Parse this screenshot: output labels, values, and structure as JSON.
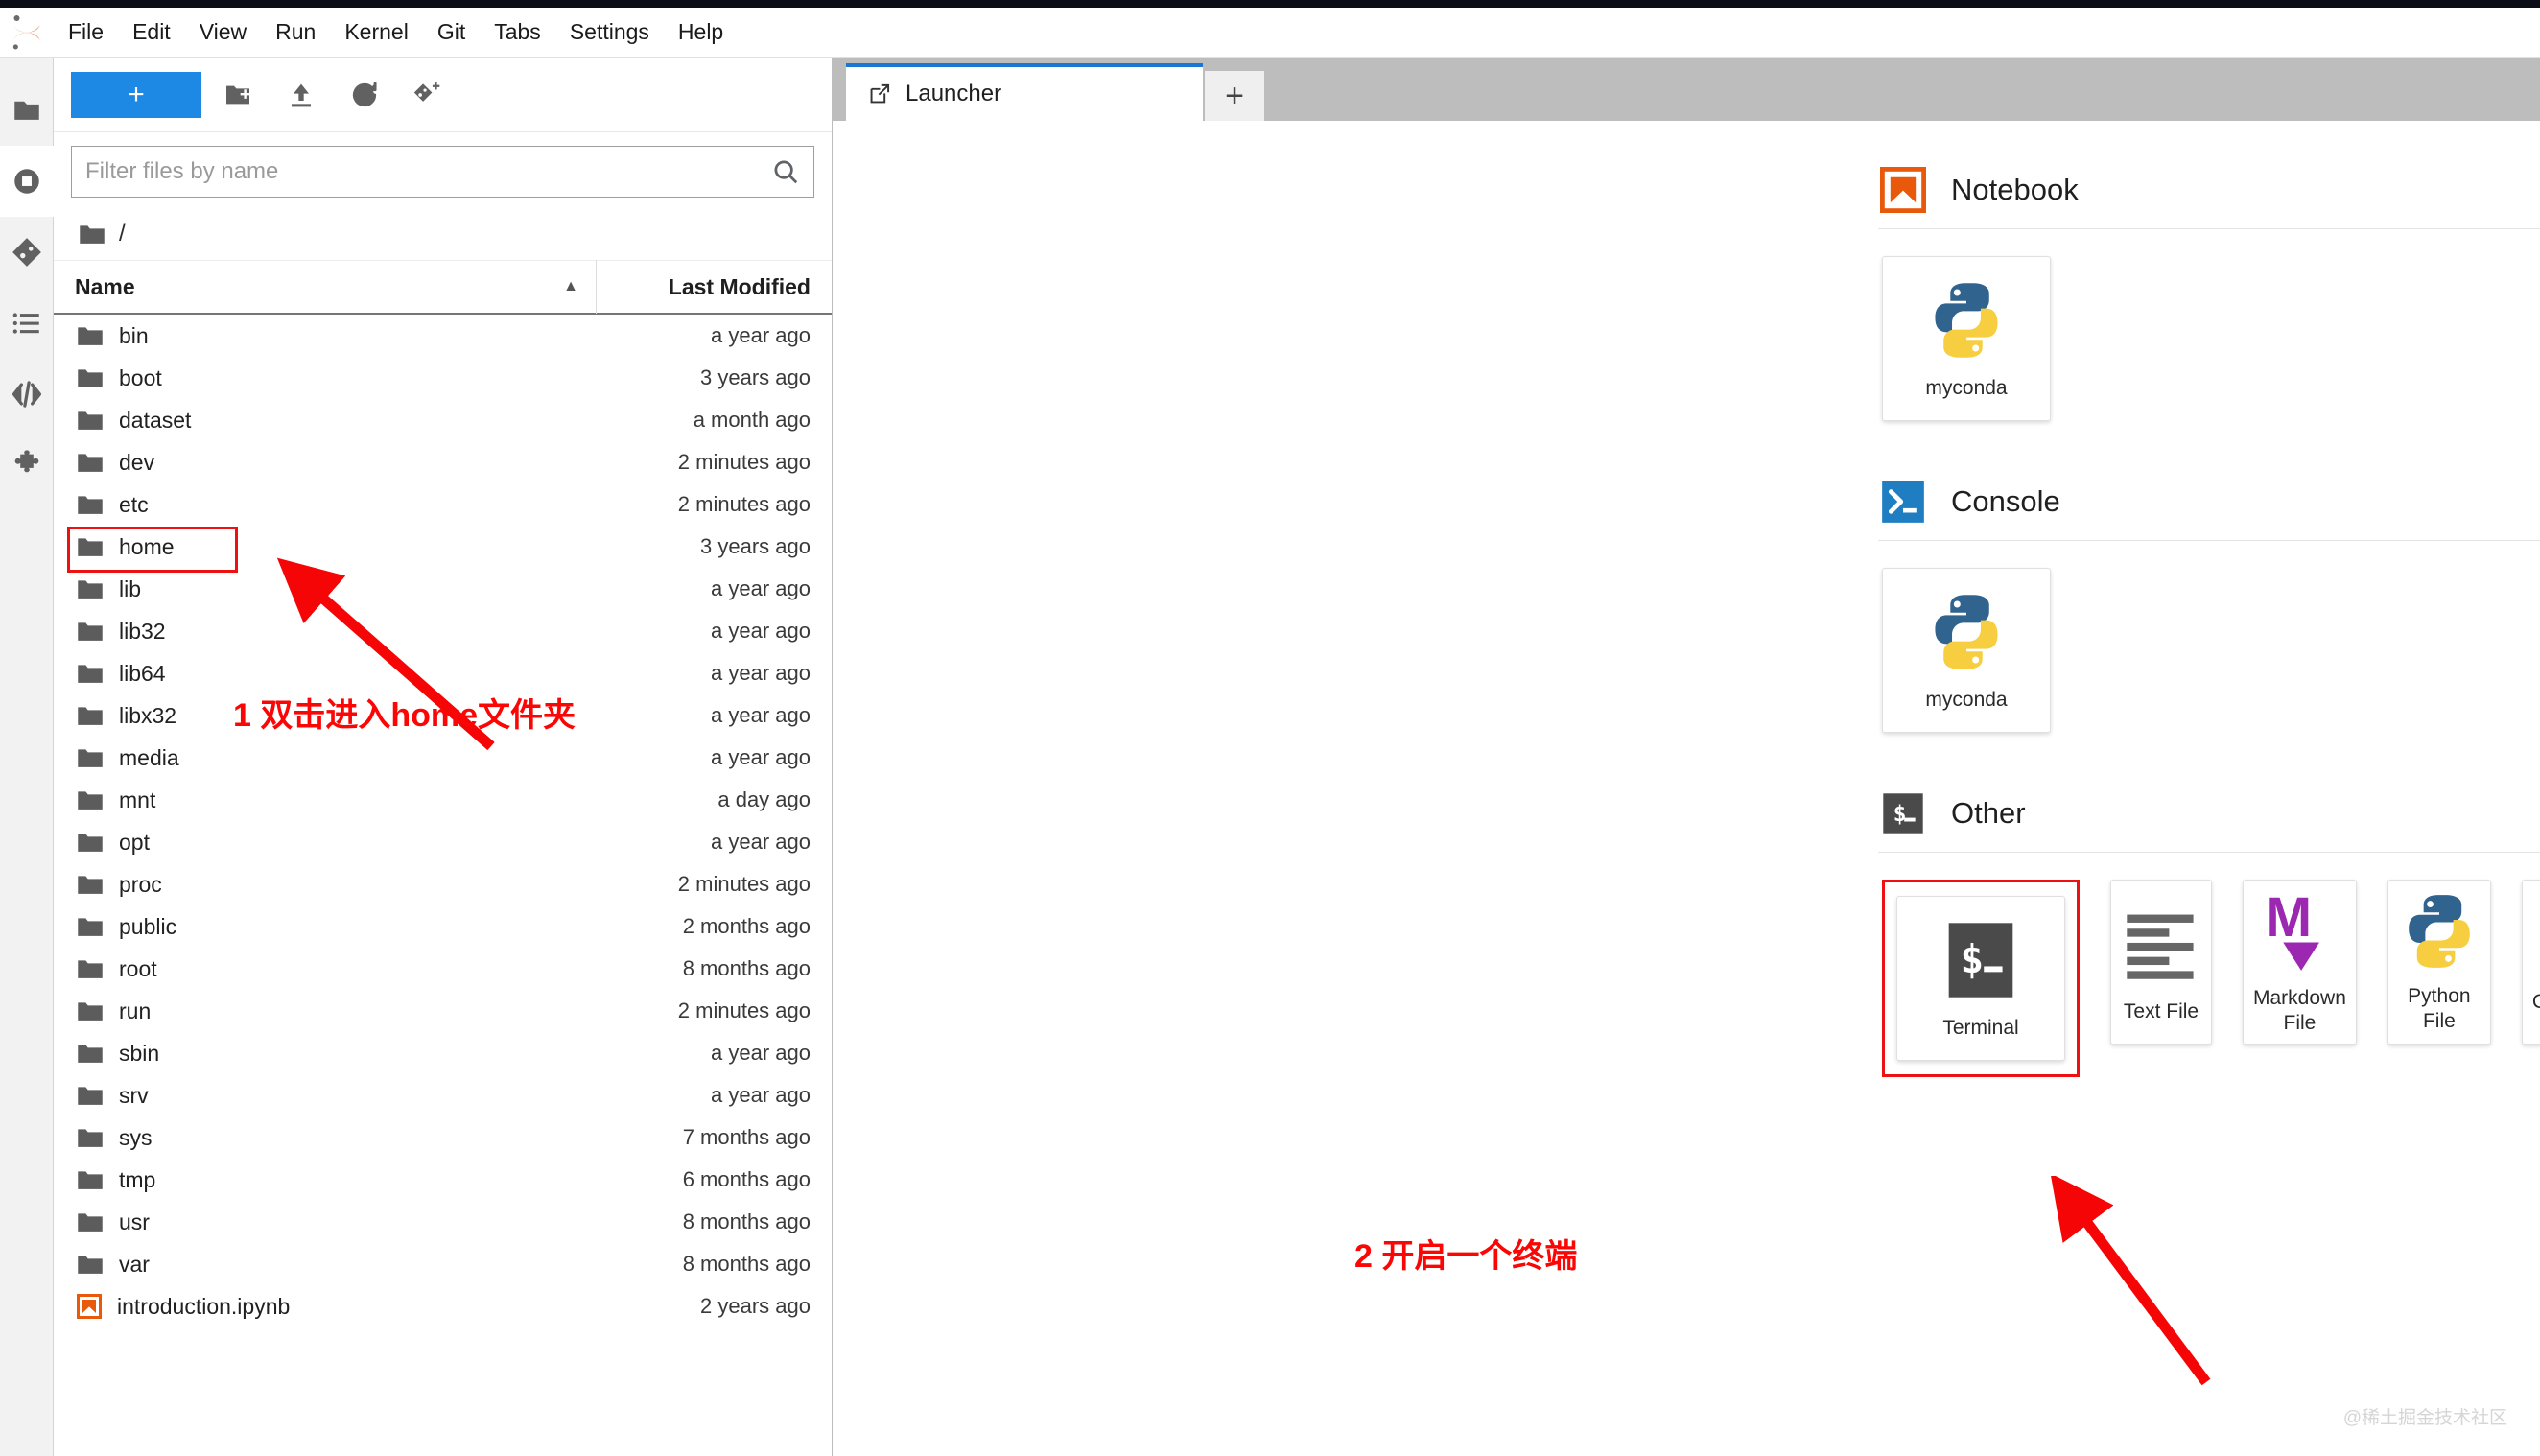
{
  "app": {
    "name": "JupyterLab",
    "logo_icon": "jupyter-logo-icon"
  },
  "menubar": {
    "items": [
      {
        "label": "File",
        "name": "menu-file"
      },
      {
        "label": "Edit",
        "name": "menu-edit"
      },
      {
        "label": "View",
        "name": "menu-view"
      },
      {
        "label": "Run",
        "name": "menu-run"
      },
      {
        "label": "Kernel",
        "name": "menu-kernel"
      },
      {
        "label": "Git",
        "name": "menu-git"
      },
      {
        "label": "Tabs",
        "name": "menu-tabs"
      },
      {
        "label": "Settings",
        "name": "menu-settings"
      },
      {
        "label": "Help",
        "name": "menu-help"
      }
    ]
  },
  "activitybar": {
    "items": [
      {
        "icon": "folder-icon",
        "name": "sidebar-file-browser",
        "active": true
      },
      {
        "icon": "running-stop-icon",
        "name": "sidebar-running-terminals",
        "active": false
      },
      {
        "icon": "git-icon",
        "name": "sidebar-git",
        "active": false
      },
      {
        "icon": "table-of-contents-icon",
        "name": "sidebar-table-of-contents",
        "active": false
      },
      {
        "icon": "code-brackets-icon",
        "name": "sidebar-code",
        "active": false
      },
      {
        "icon": "puzzle-extension-icon",
        "name": "sidebar-extension-manager",
        "active": false
      }
    ]
  },
  "filebrowser": {
    "toolbar": {
      "new_launcher_label": "+",
      "buttons": [
        {
          "icon": "new-folder-icon",
          "name": "new-folder-button"
        },
        {
          "icon": "upload-icon",
          "name": "upload-files-button"
        },
        {
          "icon": "refresh-icon",
          "name": "refresh-file-list-button"
        },
        {
          "icon": "new-git-checkpoint-icon",
          "name": "git-clone-button"
        }
      ]
    },
    "filter": {
      "placeholder": "Filter files by name",
      "value": "",
      "icon": "search-icon"
    },
    "breadcrumb": {
      "icon": "folder-icon",
      "path": "/"
    },
    "columns": {
      "name": "Name",
      "last_modified": "Last Modified",
      "sort_caret": "▲"
    },
    "rows": [
      {
        "name": "bin",
        "modified": "a year ago",
        "type": "folder",
        "highlighted": false
      },
      {
        "name": "boot",
        "modified": "3 years ago",
        "type": "folder",
        "highlighted": false
      },
      {
        "name": "dataset",
        "modified": "a month ago",
        "type": "folder",
        "highlighted": false
      },
      {
        "name": "dev",
        "modified": "2 minutes ago",
        "type": "folder",
        "highlighted": false
      },
      {
        "name": "etc",
        "modified": "2 minutes ago",
        "type": "folder",
        "highlighted": false
      },
      {
        "name": "home",
        "modified": "3 years ago",
        "type": "folder",
        "highlighted": true
      },
      {
        "name": "lib",
        "modified": "a year ago",
        "type": "folder",
        "highlighted": false
      },
      {
        "name": "lib32",
        "modified": "a year ago",
        "type": "folder",
        "highlighted": false
      },
      {
        "name": "lib64",
        "modified": "a year ago",
        "type": "folder",
        "highlighted": false
      },
      {
        "name": "libx32",
        "modified": "a year ago",
        "type": "folder",
        "highlighted": false
      },
      {
        "name": "media",
        "modified": "a year ago",
        "type": "folder",
        "highlighted": false
      },
      {
        "name": "mnt",
        "modified": "a day ago",
        "type": "folder",
        "highlighted": false
      },
      {
        "name": "opt",
        "modified": "a year ago",
        "type": "folder",
        "highlighted": false
      },
      {
        "name": "proc",
        "modified": "2 minutes ago",
        "type": "folder",
        "highlighted": false
      },
      {
        "name": "public",
        "modified": "2 months ago",
        "type": "folder",
        "highlighted": false
      },
      {
        "name": "root",
        "modified": "8 months ago",
        "type": "folder",
        "highlighted": false
      },
      {
        "name": "run",
        "modified": "2 minutes ago",
        "type": "folder",
        "highlighted": false
      },
      {
        "name": "sbin",
        "modified": "a year ago",
        "type": "folder",
        "highlighted": false
      },
      {
        "name": "srv",
        "modified": "a year ago",
        "type": "folder",
        "highlighted": false
      },
      {
        "name": "sys",
        "modified": "7 months ago",
        "type": "folder",
        "highlighted": false
      },
      {
        "name": "tmp",
        "modified": "6 months ago",
        "type": "folder",
        "highlighted": false
      },
      {
        "name": "usr",
        "modified": "8 months ago",
        "type": "folder",
        "highlighted": false
      },
      {
        "name": "var",
        "modified": "8 months ago",
        "type": "folder",
        "highlighted": false
      },
      {
        "name": "introduction.ipynb",
        "modified": "2 years ago",
        "type": "notebook",
        "highlighted": false
      }
    ]
  },
  "dock": {
    "tabs": [
      {
        "label": "Launcher",
        "icon": "launcher-icon",
        "active": true,
        "name": "tab-launcher"
      }
    ],
    "add_tab_label": "+"
  },
  "launcher": {
    "sections": [
      {
        "title": "Notebook",
        "icon": "notebook-bookmark-icon",
        "name": "launcher-section-notebook",
        "cards": [
          {
            "label": "myconda",
            "icon": "python-logo-icon",
            "name": "launcher-card-notebook-myconda",
            "highlighted": false
          }
        ]
      },
      {
        "title": "Console",
        "icon": "console-prompt-icon",
        "name": "launcher-section-console",
        "cards": [
          {
            "label": "myconda",
            "icon": "python-logo-icon",
            "name": "launcher-card-console-myconda",
            "highlighted": false
          }
        ]
      },
      {
        "title": "Other",
        "icon": "terminal-dollar-icon",
        "name": "launcher-section-other",
        "cards": [
          {
            "label": "Terminal",
            "icon": "terminal-dollar-icon",
            "name": "launcher-card-terminal",
            "highlighted": true
          },
          {
            "label": "Text File",
            "icon": "text-lines-icon",
            "name": "launcher-card-text-file",
            "highlighted": false
          },
          {
            "label": "Markdown File",
            "icon": "markdown-m-icon",
            "name": "launcher-card-markdown-file",
            "highlighted": false
          },
          {
            "label": "Python File",
            "icon": "python-logo-icon",
            "name": "launcher-card-python-file",
            "highlighted": false
          },
          {
            "label": "Show Contextual Help",
            "icon": "contextual-help-icon",
            "name": "launcher-card-contextual-help",
            "highlighted": false
          }
        ]
      }
    ]
  },
  "annotations": [
    {
      "text": "1 双击进入home文件夹",
      "name": "annotation-step-1",
      "color": "#fb0505"
    },
    {
      "text": "2 开启一个终端",
      "name": "annotation-step-2",
      "color": "#fb0505"
    }
  ],
  "watermark": {
    "text": "@稀土掘金技术社区"
  },
  "colors": {
    "accent_blue": "#1e88e5",
    "tab_active_border": "#1976d2",
    "annotation_red": "#fb0505",
    "notebook_orange": "#e8590c",
    "console_blue": "#1f7ec2",
    "terminal_dark": "#4a4a4a",
    "markdown_purple": "#9c27b0",
    "python_blue": "#30648f",
    "python_yellow": "#f6ce3f"
  }
}
